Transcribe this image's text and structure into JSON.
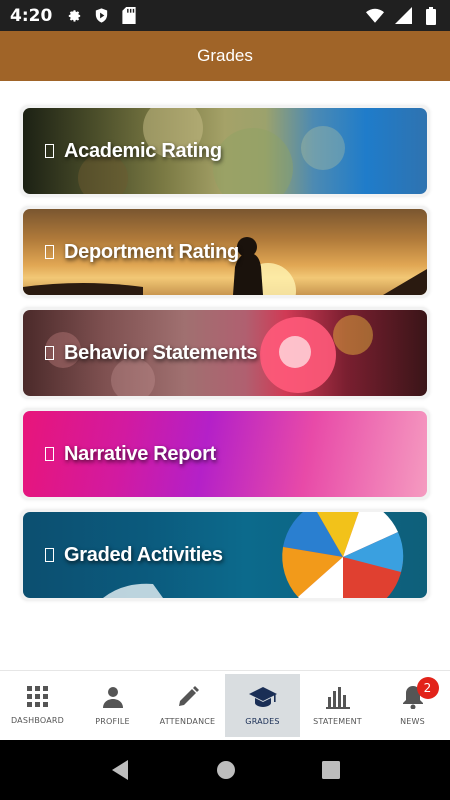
{
  "status_bar": {
    "time": "4:20"
  },
  "app_bar": {
    "title": "Grades"
  },
  "cards": [
    {
      "label": "Academic Rating"
    },
    {
      "label": "Deportment Rating"
    },
    {
      "label": "Behavior Statements"
    },
    {
      "label": "Narrative Report"
    },
    {
      "label": "Graded Activities"
    }
  ],
  "bottom_nav": {
    "items": [
      {
        "label": "DASHBOARD",
        "icon": "grid-icon"
      },
      {
        "label": "PROFILE",
        "icon": "person-icon"
      },
      {
        "label": "ATTENDANCE",
        "icon": "pencil-icon"
      },
      {
        "label": "GRADES",
        "icon": "graduation-cap-icon"
      },
      {
        "label": "STATEMENT",
        "icon": "bar-chart-icon"
      },
      {
        "label": "NEWS",
        "icon": "bell-icon"
      }
    ],
    "news_badge": "2",
    "active_color": "#1a2e55"
  },
  "colors": {
    "app_bar": "#a06428",
    "badge": "#e2231a"
  }
}
